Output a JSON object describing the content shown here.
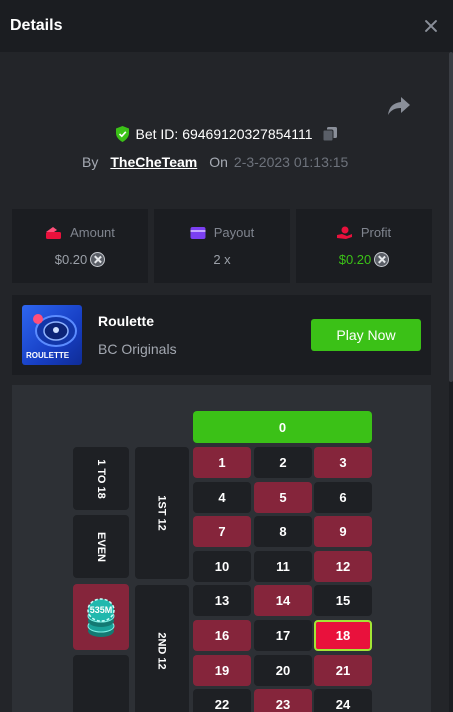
{
  "header": {
    "title": "Details"
  },
  "bet": {
    "id_text": "Bet ID: 69469120327854111",
    "by_label": "By",
    "user": "TheCheTeam",
    "on_label": "On",
    "date": "2-3-2023 01:13:15"
  },
  "stats": {
    "amount": {
      "label": "Amount",
      "value": "$0.20",
      "icon": "wallet-icon"
    },
    "payout": {
      "label": "Payout",
      "value": "2 x",
      "icon": "card-icon"
    },
    "profit": {
      "label": "Profit",
      "value": "$0.20",
      "icon": "hand-coin-icon"
    }
  },
  "game": {
    "thumb_label": "ROULETTE",
    "name": "Roulette",
    "provider": "BC Originals",
    "play_label": "Play Now"
  },
  "board": {
    "zero": "0",
    "side_labels": {
      "low": "1 TO 18",
      "even": "EVEN",
      "dozen1": "1ST 12",
      "dozen2": "2ND 12"
    },
    "chip_label": "535M",
    "selected_number": "18",
    "rows": [
      [
        {
          "n": "1",
          "c": "red"
        },
        {
          "n": "2",
          "c": "black"
        },
        {
          "n": "3",
          "c": "red"
        }
      ],
      [
        {
          "n": "4",
          "c": "black"
        },
        {
          "n": "5",
          "c": "red"
        },
        {
          "n": "6",
          "c": "black"
        }
      ],
      [
        {
          "n": "7",
          "c": "red"
        },
        {
          "n": "8",
          "c": "black"
        },
        {
          "n": "9",
          "c": "red"
        }
      ],
      [
        {
          "n": "10",
          "c": "black"
        },
        {
          "n": "11",
          "c": "black"
        },
        {
          "n": "12",
          "c": "red"
        }
      ],
      [
        {
          "n": "13",
          "c": "black"
        },
        {
          "n": "14",
          "c": "red"
        },
        {
          "n": "15",
          "c": "black"
        }
      ],
      [
        {
          "n": "16",
          "c": "red"
        },
        {
          "n": "17",
          "c": "black"
        },
        {
          "n": "18",
          "c": "red"
        }
      ],
      [
        {
          "n": "19",
          "c": "red"
        },
        {
          "n": "20",
          "c": "black"
        },
        {
          "n": "21",
          "c": "red"
        }
      ],
      [
        {
          "n": "22",
          "c": "black"
        },
        {
          "n": "23",
          "c": "red"
        },
        {
          "n": "24",
          "c": "black"
        }
      ]
    ]
  },
  "colors": {
    "accent_green": "#3bc117",
    "red_cell": "#85253b",
    "selected": "#e9113c"
  }
}
